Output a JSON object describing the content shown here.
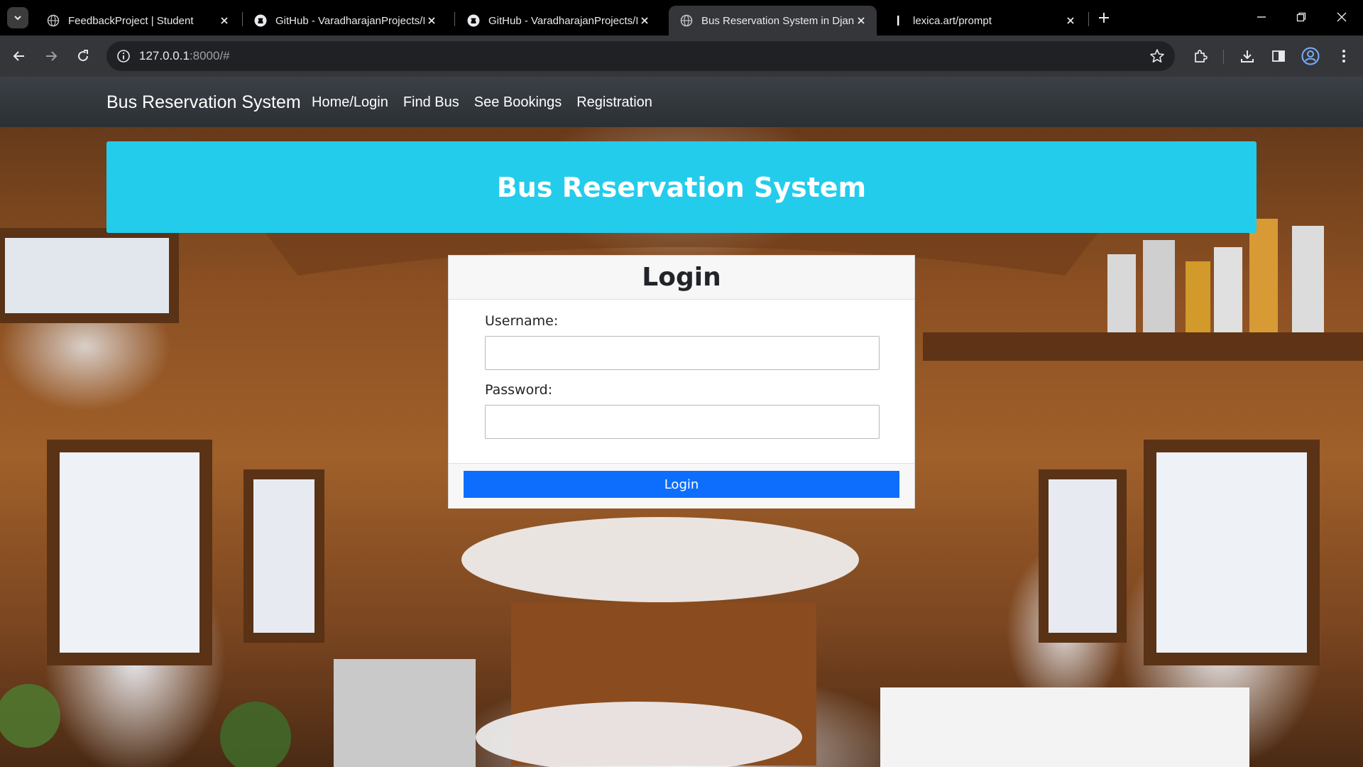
{
  "browser": {
    "tabs": [
      {
        "title": "FeedbackProject | Student",
        "icon": "globe-icon",
        "active": false
      },
      {
        "title": "GitHub - VaradharajanProjects/I",
        "icon": "github-icon",
        "active": false
      },
      {
        "title": "GitHub - VaradharajanProjects/I",
        "icon": "github-icon",
        "active": false
      },
      {
        "title": "Bus Reservation System in Djang",
        "icon": "globe-icon",
        "active": true
      },
      {
        "title": "lexica.art/prompt",
        "icon": "cursor-icon",
        "active": false
      }
    ],
    "url_host": "127.0.0.1",
    "url_rest": ":8000/#"
  },
  "navbar": {
    "brand": "Bus Reservation System",
    "links": [
      "Home/Login",
      "Find Bus",
      "See Bookings",
      "Registration"
    ]
  },
  "hero": {
    "title": "Bus Reservation System",
    "color": "#24ccec"
  },
  "login": {
    "heading": "Login",
    "username_label": "Username:",
    "password_label": "Password:",
    "button_label": "Login",
    "button_color": "#0d6efd"
  }
}
